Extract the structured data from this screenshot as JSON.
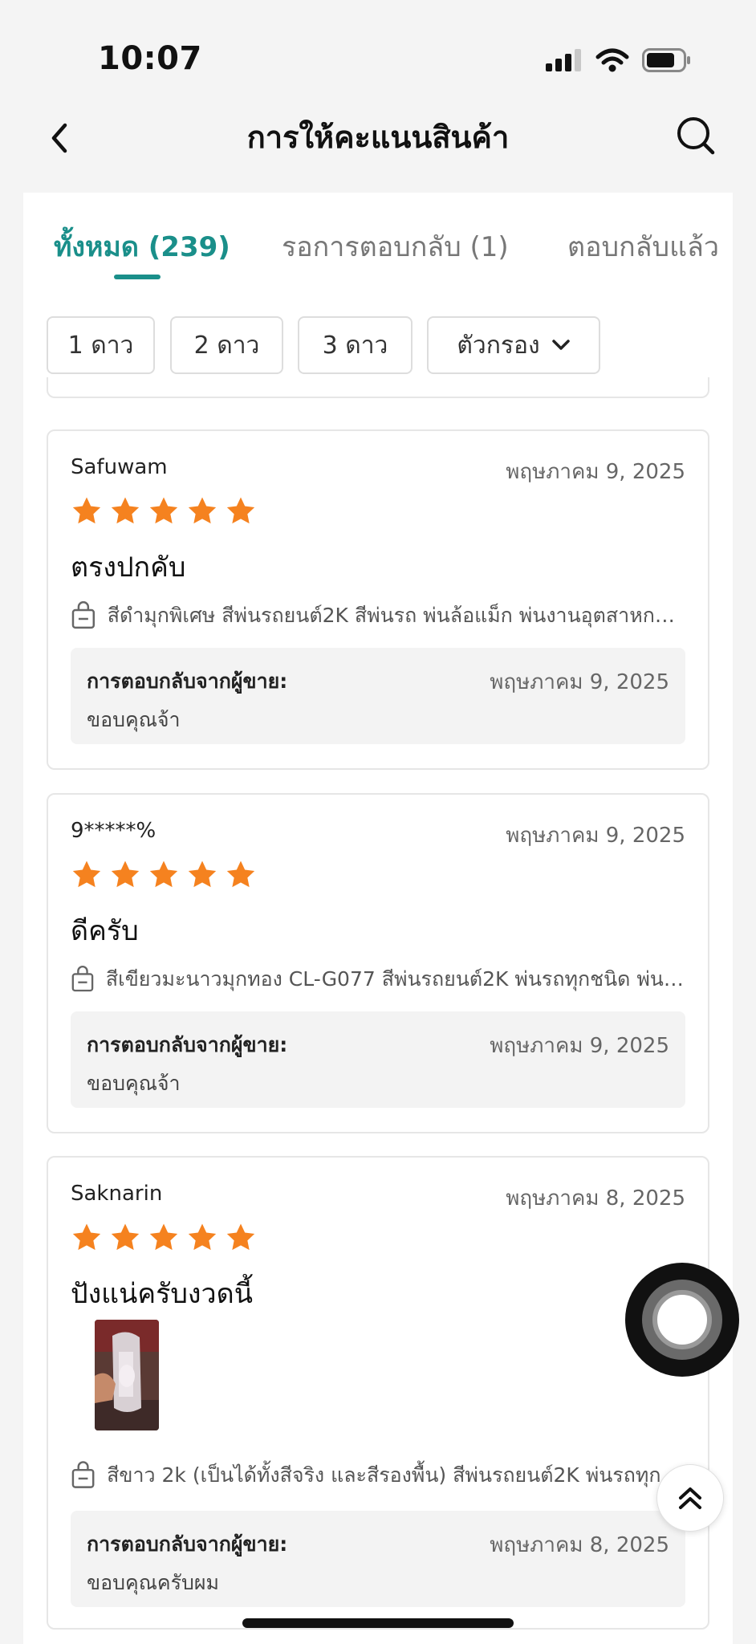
{
  "status_bar": {
    "time": "10:07"
  },
  "header": {
    "title": "การให้คะแนนสินค้า"
  },
  "tabs": [
    {
      "label": "ทั้งหมด (239)",
      "active": true
    },
    {
      "label": "รอการตอบกลับ (1)",
      "active": false
    },
    {
      "label": "ตอบกลับแล้ว",
      "active": false
    }
  ],
  "filters": [
    {
      "label": "1 ดาว"
    },
    {
      "label": "2 ดาว"
    },
    {
      "label": "3 ดาว"
    },
    {
      "label": "ตัวกรอง"
    }
  ],
  "reviews": [
    {
      "reviewer": "Safuwam",
      "date": "พฤษภาคม 9, 2025",
      "rating": 5,
      "text": "ตรงปกคับ",
      "variant": "สีดำมุกพิเศษ สีพ่นรถยนต์2K สีพ่นรถ พ่นล้อแม็ก พ่นงานอุตสาหกรรม",
      "reply_label": "การตอบกลับจากผู้ขาย:",
      "reply_date": "พฤษภาคม 9, 2025",
      "reply_text": "ขอบคุณจ้า"
    },
    {
      "reviewer": "9*****%",
      "date": "พฤษภาคม 9, 2025",
      "rating": 5,
      "text": "ดีครับ",
      "variant": "สีเขียวมะนาวมุกทอง  CL-G077 สีพ่นรถยนต์2K พ่นรถทุกชนิด พ่นล้อแม็ก",
      "reply_label": "การตอบกลับจากผู้ขาย:",
      "reply_date": "พฤษภาคม 9, 2025",
      "reply_text": "ขอบคุณจ้า"
    },
    {
      "reviewer": "Saknarin",
      "date": "พฤษภาคม 8, 2025",
      "rating": 5,
      "text": "ปังแน่ครับงวดนี้",
      "variant": "สีขาว 2k (เป็นได้ทั้งสีจริง และสีรองพื้น) สีพ่นรถยนต์2K พ่นรถทุกชนิด",
      "reply_label": "การตอบกลับจากผู้ขาย:",
      "reply_date": "พฤษภาคม 8, 2025",
      "reply_text": "ขอบคุณครับผม"
    }
  ],
  "icons": {
    "back": "chevron-left-icon",
    "search": "search-icon",
    "star": "star-icon",
    "bag": "shopping-bag-icon",
    "dropdown": "chevron-down-icon",
    "scroll_top": "double-chevron-up-icon"
  },
  "colors": {
    "accent": "#1a8f8a",
    "star": "#f5821f"
  }
}
